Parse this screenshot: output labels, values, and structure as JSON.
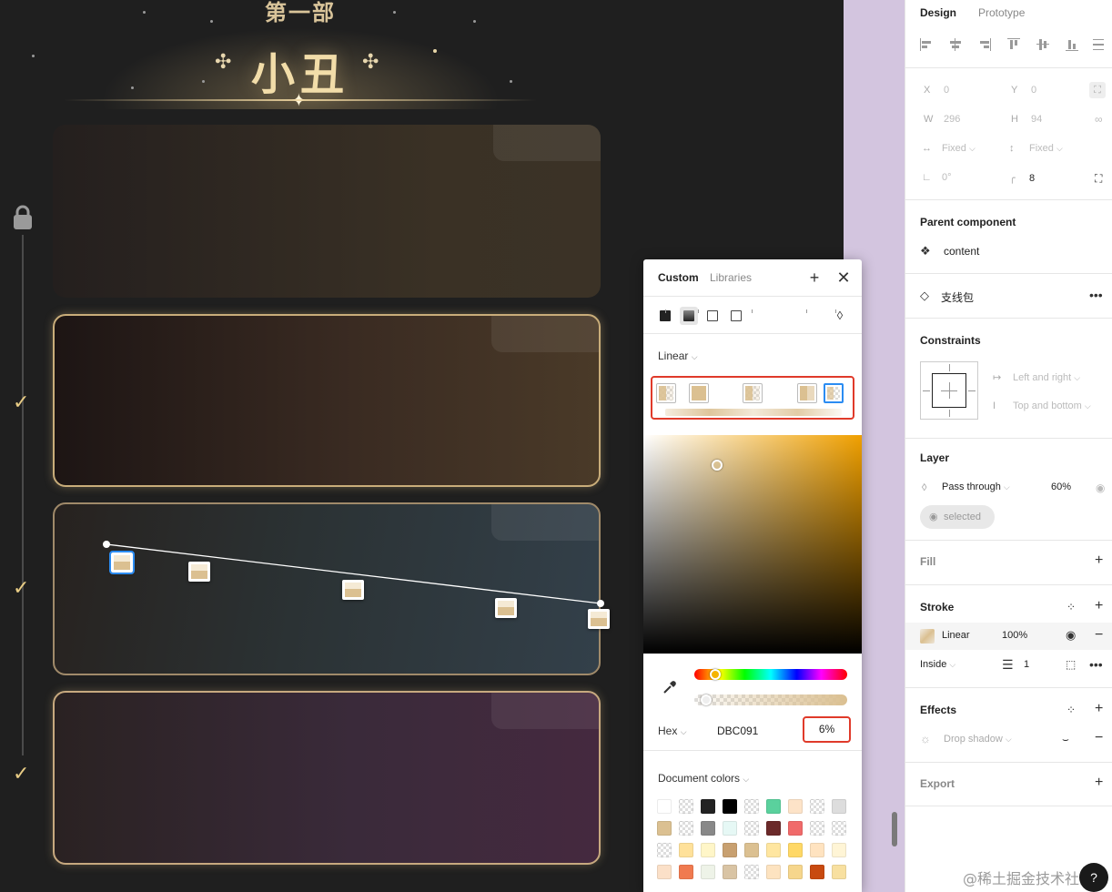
{
  "canvas": {
    "title_top": "第一部",
    "title_main": "小丑",
    "checks": [
      "✓",
      "✓",
      "✓"
    ],
    "watermark": "@稀土掘金技术社区"
  },
  "picker": {
    "tabs": [
      "Custom",
      "Libraries"
    ],
    "paint_types": [
      "solid",
      "gradient",
      "image",
      "video"
    ],
    "gradient_type": "Linear",
    "stops": [
      {
        "color": "rgba(219,192,145,0.45)"
      },
      {
        "color": "rgba(219,192,145,1)"
      },
      {
        "color": "rgba(219,192,145,0.45)"
      },
      {
        "color": "rgba(219,192,145,0.85)"
      },
      {
        "color": "rgba(219,192,145,0.06)"
      }
    ],
    "hex_label": "Hex",
    "hex_value": "DBC091",
    "opacity": "6%",
    "doc_colors_label": "Document colors",
    "swatches": [
      "#ffffff",
      "checker",
      "#222222",
      "#000000",
      "checker",
      "#5ad19d",
      "#fde3c8",
      "checker",
      "#dddddd",
      "#dbc091",
      "checker",
      "#888888",
      "#e6f8f5",
      "checker",
      "#6b2a2a",
      "#f06a6a",
      "checker",
      "checker",
      "checker",
      "#ffe19a",
      "#fff6c8",
      "#c8a070",
      "#dbc091",
      "#ffe6a0",
      "#ffd866",
      "#ffe3c0",
      "#fff5d6",
      "#fbe0c8",
      "#f07a50",
      "#eef3e8",
      "#d9c4a4",
      "checker",
      "#fde3c0",
      "#f6d68c",
      "#c84a10",
      "#f8e0a0"
    ]
  },
  "panel": {
    "tabs": [
      "Design",
      "Prototype"
    ],
    "x": "0",
    "y": "0",
    "w": "296",
    "h": "94",
    "w_mode": "Fixed",
    "h_mode": "Fixed",
    "rotation": "0°",
    "radius": "8",
    "parent_component_label": "Parent component",
    "parent_component": "content",
    "component_name": "支线包",
    "constraints_label": "Constraints",
    "constraint_h": "Left and right",
    "constraint_v": "Top and bottom",
    "layer_label": "Layer",
    "blend": "Pass through",
    "layer_opacity": "60%",
    "selected_label": "selected",
    "fill_label": "Fill",
    "stroke_label": "Stroke",
    "stroke_type": "Linear",
    "stroke_opacity": "100%",
    "stroke_position": "Inside",
    "stroke_weight": "1",
    "effects_label": "Effects",
    "effect": "Drop shadow",
    "export_label": "Export"
  }
}
